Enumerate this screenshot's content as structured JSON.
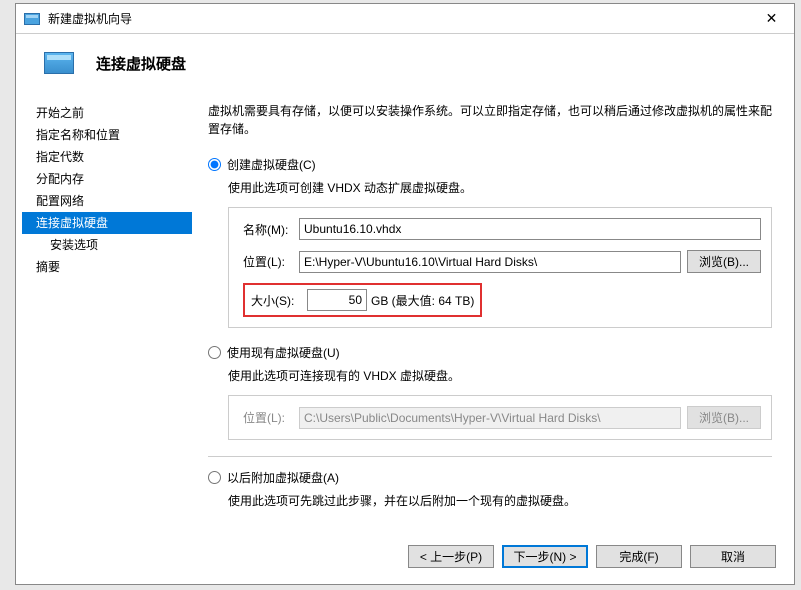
{
  "titlebar": {
    "title": "新建虚拟机向导",
    "close": "✕"
  },
  "header": {
    "title": "连接虚拟硬盘"
  },
  "sidebar": {
    "items": [
      {
        "label": "开始之前"
      },
      {
        "label": "指定名称和位置"
      },
      {
        "label": "指定代数"
      },
      {
        "label": "分配内存"
      },
      {
        "label": "配置网络"
      },
      {
        "label": "连接虚拟硬盘"
      },
      {
        "label": "安装选项"
      },
      {
        "label": "摘要"
      }
    ]
  },
  "content": {
    "intro": "虚拟机需要具有存储，以便可以安装操作系统。可以立即指定存储，也可以稍后通过修改虚拟机的属性来配置存储。",
    "opt_create": {
      "label": "创建虚拟硬盘(C)",
      "desc": "使用此选项可创建 VHDX 动态扩展虚拟硬盘。",
      "name_label": "名称(M):",
      "name_value": "Ubuntu16.10.vhdx",
      "loc_label": "位置(L):",
      "loc_value": "E:\\Hyper-V\\Ubuntu16.10\\Virtual Hard Disks\\",
      "browse": "浏览(B)...",
      "size_label": "大小(S):",
      "size_value": "50",
      "size_unit": "GB (最大值: 64 TB)"
    },
    "opt_existing": {
      "label": "使用现有虚拟硬盘(U)",
      "desc": "使用此选项可连接现有的 VHDX 虚拟硬盘。",
      "loc_label": "位置(L):",
      "loc_value": "C:\\Users\\Public\\Documents\\Hyper-V\\Virtual Hard Disks\\",
      "browse": "浏览(B)..."
    },
    "opt_later": {
      "label": "以后附加虚拟硬盘(A)",
      "desc": "使用此选项可先跳过此步骤，并在以后附加一个现有的虚拟硬盘。"
    }
  },
  "footer": {
    "prev": "< 上一步(P)",
    "next": "下一步(N) >",
    "finish": "完成(F)",
    "cancel": "取消"
  }
}
